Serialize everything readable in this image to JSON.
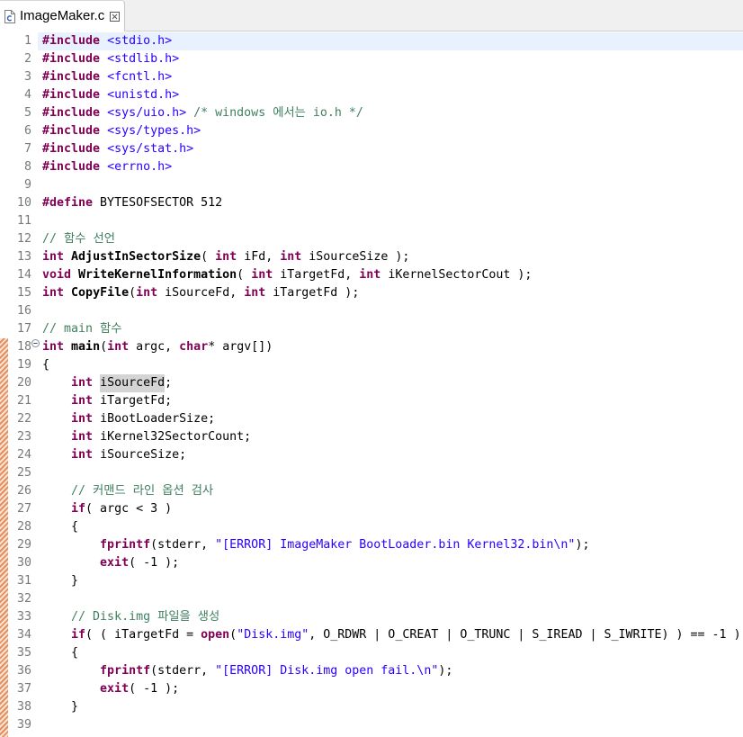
{
  "tabs": [
    {
      "label": "ImageMaker.c",
      "icon": "c-source-file-icon",
      "close_icon": "close-icon",
      "active": true
    }
  ],
  "colors": {
    "keyword": "#7f0055",
    "string": "#2a00ff",
    "comment": "#3f7f5f",
    "plain": "#000000",
    "line_number": "#787878",
    "current_line": "#e8f2fe",
    "occurrence": "#d4d4d4",
    "change_bar": "#e58f5f",
    "tab_bar": "#f0f0f0"
  },
  "editor": {
    "current_line": 1,
    "fold_lines": [
      18
    ],
    "change_marker": {
      "from_line": 18,
      "to_line": 39
    },
    "lines": [
      {
        "n": 1,
        "tokens": [
          [
            "pp",
            "#include"
          ],
          [
            "p",
            " "
          ],
          [
            "inc",
            "<stdio.h>"
          ]
        ]
      },
      {
        "n": 2,
        "tokens": [
          [
            "pp",
            "#include"
          ],
          [
            "p",
            " "
          ],
          [
            "inc",
            "<stdlib.h>"
          ]
        ]
      },
      {
        "n": 3,
        "tokens": [
          [
            "pp",
            "#include"
          ],
          [
            "p",
            " "
          ],
          [
            "inc",
            "<fcntl.h>"
          ]
        ]
      },
      {
        "n": 4,
        "tokens": [
          [
            "pp",
            "#include"
          ],
          [
            "p",
            " "
          ],
          [
            "inc",
            "<unistd.h>"
          ]
        ]
      },
      {
        "n": 5,
        "tokens": [
          [
            "pp",
            "#include"
          ],
          [
            "p",
            " "
          ],
          [
            "inc",
            "<sys/uio.h>"
          ],
          [
            "p",
            " "
          ],
          [
            "com",
            "/* windows 에서는 io.h */"
          ]
        ]
      },
      {
        "n": 6,
        "tokens": [
          [
            "pp",
            "#include"
          ],
          [
            "p",
            " "
          ],
          [
            "inc",
            "<sys/types.h>"
          ]
        ]
      },
      {
        "n": 7,
        "tokens": [
          [
            "pp",
            "#include"
          ],
          [
            "p",
            " "
          ],
          [
            "inc",
            "<sys/stat.h>"
          ]
        ]
      },
      {
        "n": 8,
        "tokens": [
          [
            "pp",
            "#include"
          ],
          [
            "p",
            " "
          ],
          [
            "inc",
            "<errno.h>"
          ]
        ]
      },
      {
        "n": 9,
        "tokens": []
      },
      {
        "n": 10,
        "tokens": [
          [
            "pp",
            "#define"
          ],
          [
            "p",
            " BYTESOFSECTOR 512"
          ]
        ]
      },
      {
        "n": 11,
        "tokens": []
      },
      {
        "n": 12,
        "tokens": [
          [
            "com",
            "// 함수 선언"
          ]
        ]
      },
      {
        "n": 13,
        "tokens": [
          [
            "kw",
            "int"
          ],
          [
            "p",
            " "
          ],
          [
            "fn",
            "AdjustInSectorSize"
          ],
          [
            "p",
            "( "
          ],
          [
            "kw",
            "int"
          ],
          [
            "p",
            " iFd, "
          ],
          [
            "kw",
            "int"
          ],
          [
            "p",
            " iSourceSize );"
          ]
        ]
      },
      {
        "n": 14,
        "tokens": [
          [
            "kw",
            "void"
          ],
          [
            "p",
            " "
          ],
          [
            "fn",
            "WriteKernelInformation"
          ],
          [
            "p",
            "( "
          ],
          [
            "kw",
            "int"
          ],
          [
            "p",
            " iTargetFd, "
          ],
          [
            "kw",
            "int"
          ],
          [
            "p",
            " iKernelSectorCout );"
          ]
        ]
      },
      {
        "n": 15,
        "tokens": [
          [
            "kw",
            "int"
          ],
          [
            "p",
            " "
          ],
          [
            "fn",
            "CopyFile"
          ],
          [
            "p",
            "("
          ],
          [
            "kw",
            "int"
          ],
          [
            "p",
            " iSourceFd, "
          ],
          [
            "kw",
            "int"
          ],
          [
            "p",
            " iTargetFd );"
          ]
        ]
      },
      {
        "n": 16,
        "tokens": []
      },
      {
        "n": 17,
        "tokens": [
          [
            "com",
            "// main 함수"
          ]
        ]
      },
      {
        "n": 18,
        "tokens": [
          [
            "kw",
            "int"
          ],
          [
            "p",
            " "
          ],
          [
            "fn",
            "main"
          ],
          [
            "p",
            "("
          ],
          [
            "kw",
            "int"
          ],
          [
            "p",
            " argc, "
          ],
          [
            "kw",
            "char"
          ],
          [
            "p",
            "* argv[])"
          ]
        ]
      },
      {
        "n": 19,
        "tokens": [
          [
            "p",
            "{"
          ]
        ]
      },
      {
        "n": 20,
        "tokens": [
          [
            "p",
            "    "
          ],
          [
            "kw",
            "int"
          ],
          [
            "p",
            " "
          ],
          [
            "occ",
            "iSourceFd"
          ],
          [
            "p",
            ";"
          ]
        ]
      },
      {
        "n": 21,
        "tokens": [
          [
            "p",
            "    "
          ],
          [
            "kw",
            "int"
          ],
          [
            "p",
            " iTargetFd;"
          ]
        ]
      },
      {
        "n": 22,
        "tokens": [
          [
            "p",
            "    "
          ],
          [
            "kw",
            "int"
          ],
          [
            "p",
            " iBootLoaderSize;"
          ]
        ]
      },
      {
        "n": 23,
        "tokens": [
          [
            "p",
            "    "
          ],
          [
            "kw",
            "int"
          ],
          [
            "p",
            " iKernel32SectorCount;"
          ]
        ]
      },
      {
        "n": 24,
        "tokens": [
          [
            "p",
            "    "
          ],
          [
            "kw",
            "int"
          ],
          [
            "p",
            " iSourceSize;"
          ]
        ]
      },
      {
        "n": 25,
        "tokens": []
      },
      {
        "n": 26,
        "tokens": [
          [
            "p",
            "    "
          ],
          [
            "com",
            "// 커맨드 라인 옵션 검사"
          ]
        ]
      },
      {
        "n": 27,
        "tokens": [
          [
            "p",
            "    "
          ],
          [
            "kw",
            "if"
          ],
          [
            "p",
            "( argc < 3 )"
          ]
        ]
      },
      {
        "n": 28,
        "tokens": [
          [
            "p",
            "    {"
          ]
        ]
      },
      {
        "n": 29,
        "tokens": [
          [
            "p",
            "        "
          ],
          [
            "call",
            "fprintf"
          ],
          [
            "p",
            "(stderr, "
          ],
          [
            "str",
            "\"[ERROR] ImageMaker BootLoader.bin Kernel32.bin\\n\""
          ],
          [
            "p",
            ");"
          ]
        ]
      },
      {
        "n": 30,
        "tokens": [
          [
            "p",
            "        "
          ],
          [
            "call",
            "exit"
          ],
          [
            "p",
            "( -1 );"
          ]
        ]
      },
      {
        "n": 31,
        "tokens": [
          [
            "p",
            "    }"
          ]
        ]
      },
      {
        "n": 32,
        "tokens": []
      },
      {
        "n": 33,
        "tokens": [
          [
            "p",
            "    "
          ],
          [
            "com",
            "// Disk.img 파일을 생성"
          ]
        ]
      },
      {
        "n": 34,
        "tokens": [
          [
            "p",
            "    "
          ],
          [
            "kw",
            "if"
          ],
          [
            "p",
            "( ( iTargetFd = "
          ],
          [
            "call",
            "open"
          ],
          [
            "p",
            "("
          ],
          [
            "str",
            "\"Disk.img\""
          ],
          [
            "p",
            ", O_RDWR | O_CREAT | O_TRUNC | S_IREAD | S_IWRITE) ) == -1 )"
          ]
        ]
      },
      {
        "n": 35,
        "tokens": [
          [
            "p",
            "    {"
          ]
        ]
      },
      {
        "n": 36,
        "tokens": [
          [
            "p",
            "        "
          ],
          [
            "call",
            "fprintf"
          ],
          [
            "p",
            "(stderr, "
          ],
          [
            "str",
            "\"[ERROR] Disk.img open fail.\\n\""
          ],
          [
            "p",
            ");"
          ]
        ]
      },
      {
        "n": 37,
        "tokens": [
          [
            "p",
            "        "
          ],
          [
            "call",
            "exit"
          ],
          [
            "p",
            "( -1 );"
          ]
        ]
      },
      {
        "n": 38,
        "tokens": [
          [
            "p",
            "    }"
          ]
        ]
      },
      {
        "n": 39,
        "tokens": []
      }
    ]
  }
}
